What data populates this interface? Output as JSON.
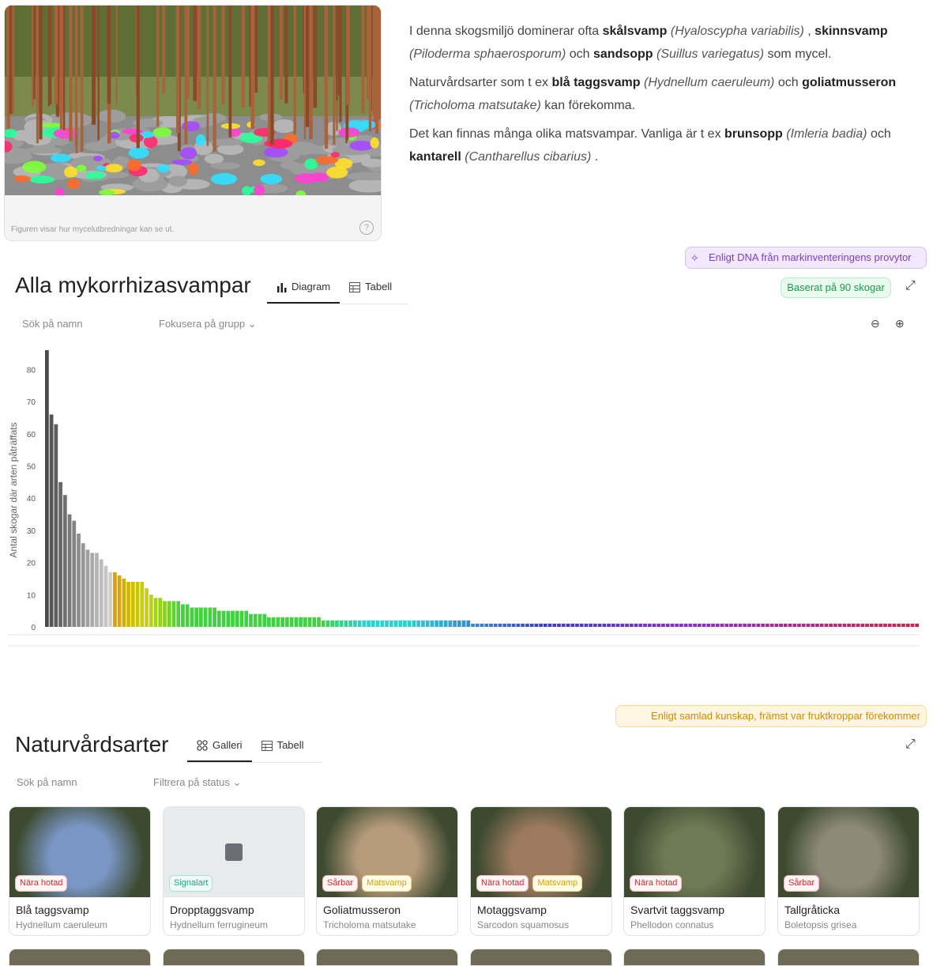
{
  "hero": {
    "caption": "Figuren visar hur mycelutbredningar kan se ut.",
    "help_icon": "question-circle-icon"
  },
  "intro": {
    "p1": [
      {
        "t": "I denna skogsmiljö dominerar ofta ",
        "s": "n"
      },
      {
        "t": "skålsvamp",
        "s": "b"
      },
      {
        "t": " ",
        "s": "n"
      },
      {
        "t": "(Hyaloscypha variabilis)",
        "s": "i"
      },
      {
        "t": " , ",
        "s": "n"
      },
      {
        "t": "skinnsvamp",
        "s": "b"
      },
      {
        "t": " ",
        "s": "n"
      },
      {
        "t": "(Piloderma sphaerosporum)",
        "s": "i"
      },
      {
        "t": " och ",
        "s": "n"
      },
      {
        "t": "sandsopp",
        "s": "b"
      },
      {
        "t": " ",
        "s": "n"
      },
      {
        "t": "(Suillus variegatus)",
        "s": "i"
      },
      {
        "t": " som mycel.",
        "s": "n"
      }
    ],
    "p2": [
      {
        "t": "Naturvårdsarter som t ex ",
        "s": "n"
      },
      {
        "t": "blå taggsvamp",
        "s": "b"
      },
      {
        "t": " ",
        "s": "n"
      },
      {
        "t": "(Hydnellum caeruleum)",
        "s": "i"
      },
      {
        "t": " och ",
        "s": "n"
      },
      {
        "t": "goliatmusseron",
        "s": "b"
      },
      {
        "t": " ",
        "s": "n"
      },
      {
        "t": "(Tricholoma matsutake)",
        "s": "i"
      },
      {
        "t": " kan förekomma.",
        "s": "n"
      }
    ],
    "p3": [
      {
        "t": "Det kan finnas många olika matsvampar. Vanliga är t ex ",
        "s": "n"
      },
      {
        "t": "brunsopp",
        "s": "b"
      },
      {
        "t": " ",
        "s": "n"
      },
      {
        "t": "(Imleria badia)",
        "s": "i"
      },
      {
        "t": " och ",
        "s": "n"
      },
      {
        "t": "kantarell",
        "s": "b"
      },
      {
        "t": " ",
        "s": "n"
      },
      {
        "t": "(Cantharellus cibarius)",
        "s": "i"
      },
      {
        "t": " .",
        "s": "n"
      }
    ]
  },
  "dna_pill": "Enligt DNA från markinventeringens provytor",
  "section1": {
    "title": "Alla mykorrhizasvampar",
    "tab_diagram": "Diagram",
    "tab_table": "Tabell",
    "based_on": "Baserat på 90 skogar",
    "search_placeholder": "Sök på namn",
    "focus_group": "Fokusera på grupp"
  },
  "chart_data": {
    "type": "bar",
    "ylabel": "Antal skogar där arten påträffats",
    "ylim": [
      0,
      86
    ],
    "yticks": [
      0,
      10,
      20,
      30,
      40,
      50,
      60,
      70,
      80
    ],
    "values": [
      86,
      66,
      63,
      45,
      41,
      35,
      33,
      29,
      26,
      24,
      23,
      23,
      21,
      19,
      17,
      17,
      16,
      15,
      14,
      14,
      14,
      14,
      12,
      10,
      9,
      9,
      8,
      8,
      8,
      8,
      7,
      7,
      6,
      6,
      6,
      6,
      6,
      6,
      5,
      5,
      5,
      5,
      5,
      5,
      5,
      4,
      4,
      4,
      4,
      3,
      3,
      3,
      3,
      3,
      3,
      3,
      3,
      3,
      3,
      3,
      3,
      2,
      2,
      2,
      2,
      2,
      2,
      2,
      2,
      2,
      2,
      2,
      2,
      2,
      2,
      2,
      2,
      2,
      2,
      2,
      2,
      2,
      2,
      2,
      2,
      2,
      2,
      2,
      2,
      2,
      2,
      2,
      2,
      2,
      1,
      1,
      1,
      1,
      1,
      1,
      1,
      1,
      1,
      1,
      1,
      1,
      1,
      1,
      1,
      1,
      1,
      1,
      1,
      1,
      1,
      1,
      1,
      1,
      1,
      1,
      1,
      1,
      1,
      1,
      1,
      1,
      1,
      1,
      1,
      1,
      1,
      1,
      1,
      1,
      1,
      1,
      1,
      1,
      1,
      1,
      1,
      1,
      1,
      1,
      1,
      1,
      1,
      1,
      1,
      1,
      1,
      1,
      1,
      1,
      1,
      1,
      1,
      1,
      1,
      1,
      1,
      1,
      1,
      1,
      1,
      1,
      1,
      1,
      1,
      1,
      1,
      1,
      1,
      1,
      1,
      1,
      1,
      1,
      1,
      1,
      1,
      1,
      1,
      1,
      1,
      1,
      1,
      1,
      1,
      1,
      1,
      1,
      1
    ],
    "colors": {
      "gray_dark": "#4a4a4a",
      "gray_light": "#cfcfcf",
      "orange": "#d9a300",
      "yellow": "#c7d400",
      "green": "#3fd43f",
      "cyan": "#2ad1d1",
      "blue": "#3a3ad6",
      "purple": "#8a2ad6",
      "red": "#d61f4a"
    }
  },
  "kun_pill": "Enligt samlad kunskap, främst var fruktkroppar förekommer",
  "section2": {
    "title": "Naturvårdsarter",
    "tab_gallery": "Galleri",
    "tab_table": "Tabell",
    "search_placeholder": "Sök på namn",
    "filter_status": "Filtrera på status"
  },
  "gallery": [
    {
      "name": "Blå taggsvamp",
      "latin": "Hydnellum caeruleum",
      "badges": [
        {
          "t": "Nära hotad",
          "c": "red"
        }
      ],
      "img": "#7a96c4"
    },
    {
      "name": "Dropptaggsvamp",
      "latin": "Hydnellum ferrugineum",
      "badges": [
        {
          "t": "Signalart",
          "c": "teal"
        }
      ],
      "img": "placeholder"
    },
    {
      "name": "Goliatmusseron",
      "latin": "Tricholoma matsutake",
      "badges": [
        {
          "t": "Sårbar",
          "c": "red"
        },
        {
          "t": "Matsvamp",
          "c": "yel"
        }
      ],
      "img": "#b59b7a"
    },
    {
      "name": "Motaggsvamp",
      "latin": "Sarcodon squamosus",
      "badges": [
        {
          "t": "Nära hotad",
          "c": "red"
        },
        {
          "t": "Matsvamp",
          "c": "yel"
        }
      ],
      "img": "#9b7a5e"
    },
    {
      "name": "Svartvit taggsvamp",
      "latin": "Phellodon connatus",
      "badges": [
        {
          "t": "Nära hotad",
          "c": "red"
        }
      ],
      "img": "#6e7a55"
    },
    {
      "name": "Tallgråticka",
      "latin": "Boletopsis grisea",
      "badges": [
        {
          "t": "Sårbar",
          "c": "red"
        }
      ],
      "img": "#8e8a7a"
    }
  ]
}
